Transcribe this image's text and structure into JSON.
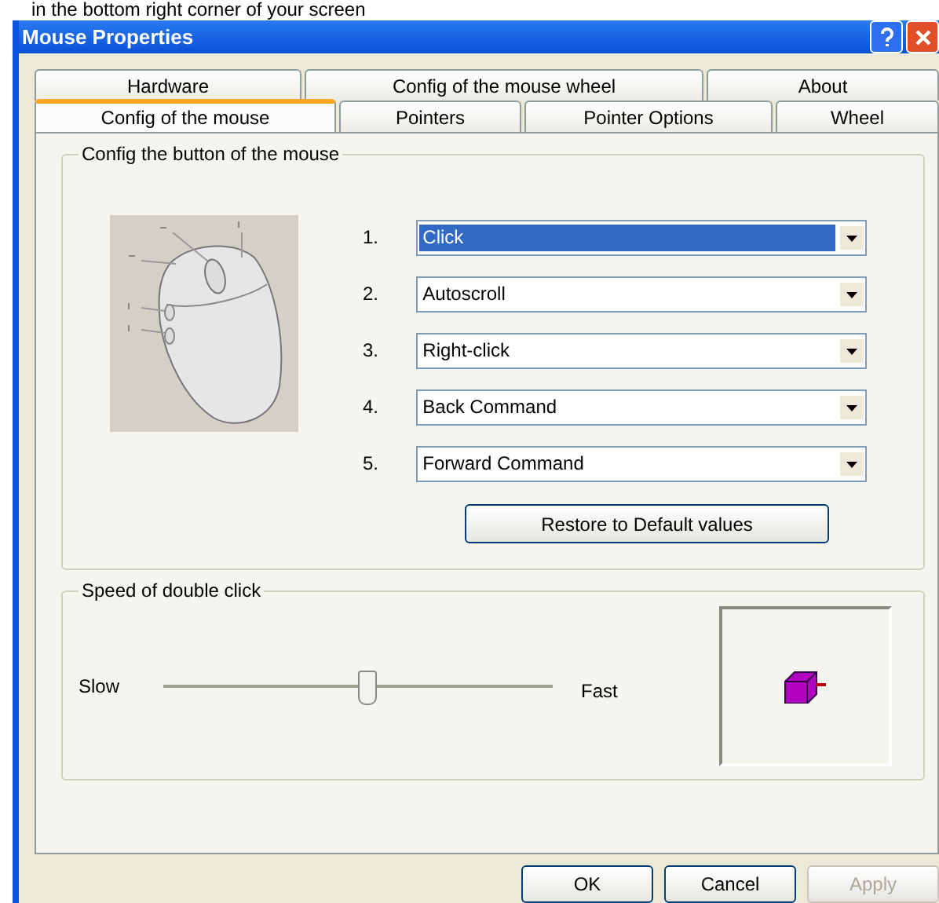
{
  "caption": "in the bottom right corner of your screen",
  "window": {
    "title": "Mouse Properties"
  },
  "tab_rows": [
    {
      "tabs": [
        {
          "label": "Hardware",
          "selected": false
        },
        {
          "label": "Config of the mouse wheel",
          "selected": false
        },
        {
          "label": "About",
          "selected": false
        }
      ]
    },
    {
      "tabs": [
        {
          "label": "Config of the mouse",
          "selected": true
        },
        {
          "label": "Pointers",
          "selected": false
        },
        {
          "label": "Pointer Options",
          "selected": false
        },
        {
          "label": "Wheel",
          "selected": false
        }
      ]
    }
  ],
  "buttons_group": {
    "title": "Config the button of the mouse",
    "assignments": [
      {
        "number": "1.",
        "value": "Click",
        "selected": true
      },
      {
        "number": "2.",
        "value": "Autoscroll",
        "selected": false
      },
      {
        "number": "3.",
        "value": "Right-click",
        "selected": false
      },
      {
        "number": "4.",
        "value": "Back Command",
        "selected": false
      },
      {
        "number": "5.",
        "value": "Forward Command",
        "selected": false
      }
    ],
    "restore_button": "Restore to Default values"
  },
  "speed_group": {
    "title": "Speed of double click",
    "slow_label": "Slow",
    "fast_label": "Fast",
    "level": 0.52
  },
  "buttons": [
    {
      "label": "OK",
      "disabled": false
    },
    {
      "label": "Cancel",
      "disabled": false
    },
    {
      "label": "Apply",
      "disabled": true
    }
  ]
}
